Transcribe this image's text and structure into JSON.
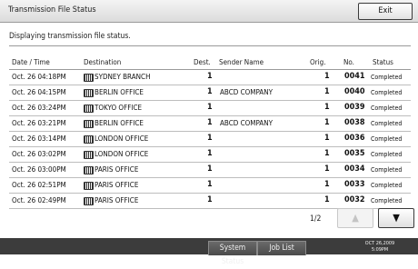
{
  "header": {
    "title": "Transmission File Status",
    "exit_label": "Exit"
  },
  "subtitle": "Displaying transmission file status.",
  "columns": {
    "date": "Date / Time",
    "destination": "Destination",
    "dest": "Dest.",
    "sender": "Sender Name",
    "orig": "Orig.",
    "no": "No.",
    "status": "Status"
  },
  "rows": [
    {
      "date": "Oct. 26  04:18PM",
      "destination": "SYDNEY BRANCH",
      "dest": "1",
      "sender": "",
      "orig": "1",
      "no": "0041",
      "status": "Completed"
    },
    {
      "date": "Oct. 26  04:15PM",
      "destination": "BERLIN OFFICE",
      "dest": "1",
      "sender": "ABCD COMPANY",
      "orig": "1",
      "no": "0040",
      "status": "Completed"
    },
    {
      "date": "Oct. 26  03:24PM",
      "destination": "TOKYO OFFICE",
      "dest": "1",
      "sender": "",
      "orig": "1",
      "no": "0039",
      "status": "Completed"
    },
    {
      "date": "Oct. 26  03:21PM",
      "destination": "BERLIN OFFICE",
      "dest": "1",
      "sender": "ABCD COMPANY",
      "orig": "1",
      "no": "0038",
      "status": "Completed"
    },
    {
      "date": "Oct. 26  03:14PM",
      "destination": "LONDON OFFICE",
      "dest": "1",
      "sender": "",
      "orig": "1",
      "no": "0036",
      "status": "Completed"
    },
    {
      "date": "Oct. 26  03:02PM",
      "destination": "LONDON OFFICE",
      "dest": "1",
      "sender": "",
      "orig": "1",
      "no": "0035",
      "status": "Completed"
    },
    {
      "date": "Oct. 26  03:00PM",
      "destination": "PARIS OFFICE",
      "dest": "1",
      "sender": "",
      "orig": "1",
      "no": "0034",
      "status": "Completed"
    },
    {
      "date": "Oct. 26  02:51PM",
      "destination": "PARIS OFFICE",
      "dest": "1",
      "sender": "",
      "orig": "1",
      "no": "0033",
      "status": "Completed"
    },
    {
      "date": "Oct. 26  02:49PM",
      "destination": "PARIS OFFICE",
      "dest": "1",
      "sender": "",
      "orig": "1",
      "no": "0032",
      "status": "Completed"
    }
  ],
  "pagination": {
    "page": "1/2",
    "up_icon": "triangle-up-icon",
    "down_icon": "triangle-down-icon",
    "up_glyph": "▲",
    "down_glyph": "▼"
  },
  "footer": {
    "system_status": "System Status",
    "job_list": "Job List",
    "date": "OCT  26,2009",
    "time": "5:09PM"
  }
}
